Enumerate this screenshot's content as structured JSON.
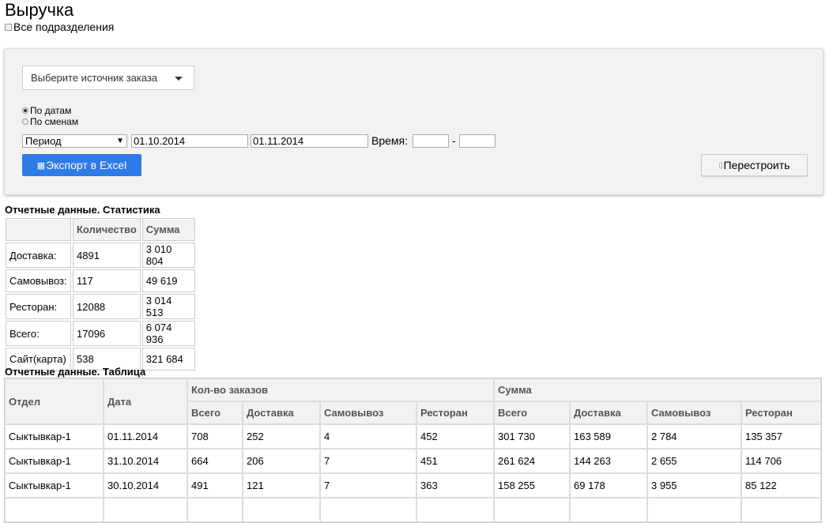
{
  "page": {
    "title": "Выручка",
    "all_departments": "Все подразделения"
  },
  "filters": {
    "source_placeholder": "Выберите источник заказа",
    "radio_dates": "По датам",
    "radio_shifts": "По сменам",
    "period": "Период",
    "date_from": "01.10.2014",
    "date_to": "01.11.2014",
    "time_label": "Время:",
    "time_sep": "-",
    "export_label": "Экспорт в Excel",
    "rebuild_label": "Перестроить"
  },
  "stats": {
    "title": "Отчетные данные. Статистика",
    "headers": [
      "",
      "Количество",
      "Сумма"
    ],
    "rows": [
      [
        "Доставка:",
        "4891",
        "3 010 804"
      ],
      [
        "Самовывоз:",
        "117",
        "49 619"
      ],
      [
        "Ресторан:",
        "12088",
        "3 014 513"
      ],
      [
        "Всего:",
        "17096",
        "6 074 936"
      ],
      [
        "Сайт(карта)",
        "538",
        "321 684"
      ]
    ]
  },
  "table": {
    "title": "Отчетные данные. Таблица",
    "col_dept": "Отдел",
    "col_date": "Дата",
    "group_orders": "Кол-во заказов",
    "group_sum": "Сумма",
    "sub_headers": [
      "Всего",
      "Доставка",
      "Самовывоз",
      "Ресторан",
      "Всего",
      "Доставка",
      "Самовывоз",
      "Ресторан"
    ],
    "rows": [
      [
        "Сыктывкар-1",
        "01.11.2014",
        "708",
        "252",
        "4",
        "452",
        "301 730",
        "163 589",
        "2 784",
        "135 357"
      ],
      [
        "Сыктывкар-1",
        "31.10.2014",
        "664",
        "206",
        "7",
        "451",
        "261 624",
        "144 263",
        "2 655",
        "114 706"
      ],
      [
        "Сыктывкар-1",
        "30.10.2014",
        "491",
        "121",
        "7",
        "363",
        "158 255",
        "69 178",
        "3 955",
        "85 122"
      ]
    ]
  }
}
